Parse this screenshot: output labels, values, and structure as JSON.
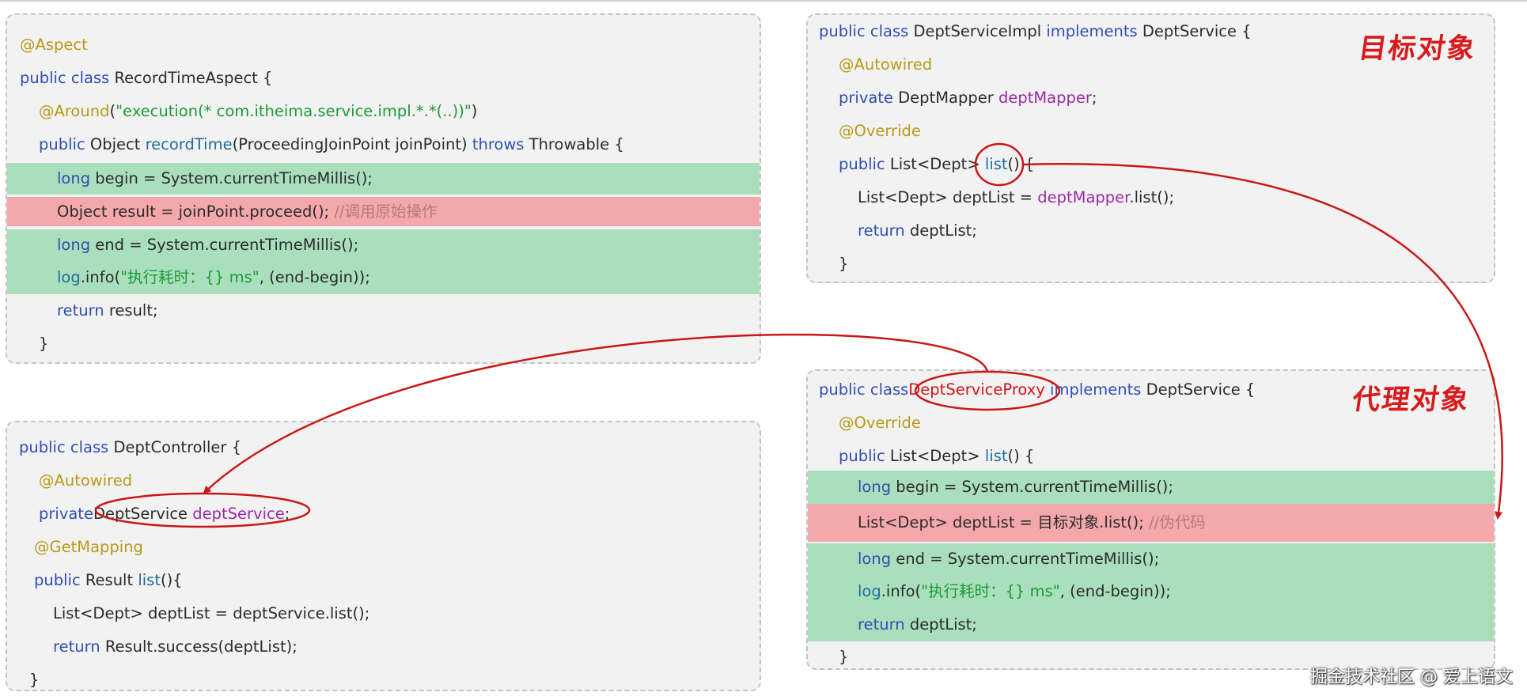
{
  "aspect": {
    "annotation": "@Aspect",
    "kw_public": "public",
    "kw_class": "class",
    "class_name": " RecordTimeAspect {",
    "around_annotation": "@Around",
    "around_open": "(",
    "around_expr": "\"execution(* com.itheima.service.impl.*.*(..))\"",
    "around_close": ")",
    "method_kw_public": "public",
    "method_return": " Object ",
    "method_name": "recordTime",
    "method_params": "(ProceedingJoinPoint joinPoint) ",
    "method_throws": "throws",
    "method_tail": " Throwable {",
    "l5_type": "long",
    "l5_rest": " begin = System.currentTimeMillis();",
    "l6_code": "Object result = joinPoint.proceed();",
    "l6_comment": "//调用原始操作",
    "l7_type": "long",
    "l7_rest": " end = System.currentTimeMillis();",
    "l8_log": "log",
    "l8_mid": ".info(",
    "l8_str": "\"执行耗时：{} ms\"",
    "l8_tail": ", (end-begin));",
    "l9_return": "return",
    "l9_rest": " result;",
    "l10_brace": "}"
  },
  "controller": {
    "kw_public": "public",
    "kw_class": "class",
    "class_name": " DeptController {",
    "autowired": "@Autowired",
    "private_kw": "private",
    "field_type": "DeptService ",
    "field_name": "deptService",
    "field_semi": ";",
    "getmapping": "@GetMapping",
    "method_kw_public": "public",
    "method_return": " Result ",
    "method_name": "list",
    "method_tail": "(){",
    "l6_code": "List<Dept> deptList = deptService.list();",
    "l7_return": "return",
    "l7_rest": " Result.success(deptList);",
    "l8_brace": "}"
  },
  "target": {
    "kw_public": "public",
    "kw_class": "class",
    "class_name": " DeptServiceImpl ",
    "implements_kw": "implements",
    "iface_name": " DeptService {",
    "autowired": "@Autowired",
    "private_kw": "private",
    "field_type": " DeptMapper ",
    "field_name": "deptMapper",
    "field_semi": ";",
    "override": "@Override",
    "method_kw_public": "public",
    "method_sig": " List<Dept> ",
    "method_name": "list",
    "method_tail": "() {",
    "l6_pre": "List<Dept> deptList = ",
    "l6_field": "deptMapper",
    "l6_post": ".list();",
    "l7_return": "return",
    "l7_rest": " deptList;",
    "l8_brace": "}",
    "label": "目标对象"
  },
  "proxy": {
    "kw_public": "public",
    "kw_class": "class",
    "class_name": "DeptServiceProxy",
    "implements_kw": "implements",
    "iface_name": " DeptService {",
    "override": "@Override",
    "method_kw_public": "public",
    "method_sig": " List<Dept> ",
    "method_name": "list",
    "method_tail": "() {",
    "l4_type": "long",
    "l4_rest": " begin = System.currentTimeMillis();",
    "l5_code": "List<Dept> deptList = 目标对象.list();",
    "l5_comment": "//伪代码",
    "l6_type": "long",
    "l6_rest": " end = System.currentTimeMillis();",
    "l7_log": "log",
    "l7_mid": ".info(",
    "l7_str": "\"执行耗时：{} ms\"",
    "l7_tail": ", (end-begin));",
    "l8_return": "return",
    "l8_rest": " deptList;",
    "l9_brace": "}",
    "label": "代理对象"
  },
  "watermark": "掘金技术社区 @ 爱上语文",
  "colors": {
    "keyword": "#2e4fb3",
    "annotation": "#b89a18",
    "string": "#1c9b36",
    "method": "#1e6d9c",
    "field": "#9c2aa6",
    "comment": "#b57a7c",
    "highlight_green": "#aadfbd",
    "highlight_red": "#f5a8ac",
    "arrow_red": "#c81818"
  }
}
